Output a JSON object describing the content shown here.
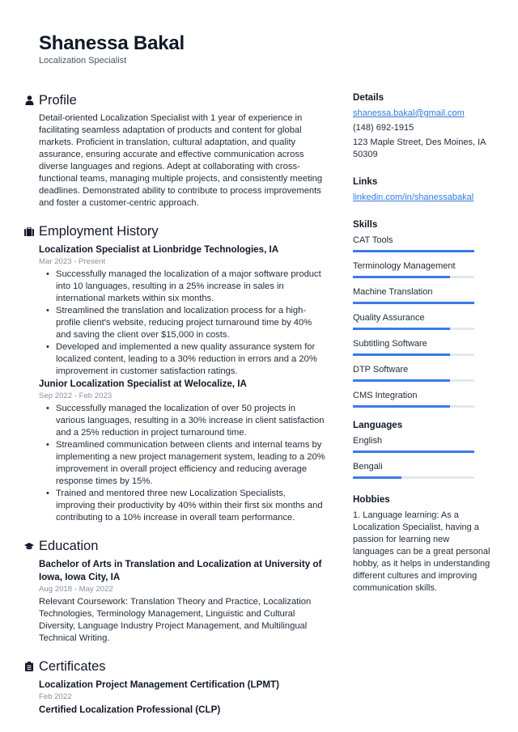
{
  "header": {
    "name": "Shanessa Bakal",
    "role": "Localization Specialist"
  },
  "profile": {
    "title": "Profile",
    "icon": "person-icon",
    "text": "Detail-oriented Localization Specialist with 1 year of experience in facilitating seamless adaptation of products and content for global markets. Proficient in translation, cultural adaptation, and quality assurance, ensuring accurate and effective communication across diverse languages and regions. Adept at collaborating with cross-functional teams, managing multiple projects, and consistently meeting deadlines. Demonstrated ability to contribute to process improvements and foster a customer-centric approach."
  },
  "employment": {
    "title": "Employment History",
    "icon": "briefcase-icon",
    "jobs": [
      {
        "title": "Localization Specialist at Lionbridge Technologies, IA",
        "dates": "Mar 2023 - Present",
        "bullets": [
          "Successfully managed the localization of a major software product into 10 languages, resulting in a 25% increase in sales in international markets within six months.",
          "Streamlined the translation and localization process for a high-profile client's website, reducing project turnaround time by 40% and saving the client over $15,000 in costs.",
          "Developed and implemented a new quality assurance system for localized content, leading to a 30% reduction in errors and a 20% improvement in customer satisfaction ratings."
        ]
      },
      {
        "title": "Junior Localization Specialist at Welocalize, IA",
        "dates": "Sep 2022 - Feb 2023",
        "bullets": [
          "Successfully managed the localization of over 50 projects in various languages, resulting in a 30% increase in client satisfaction and a 25% reduction in project turnaround time.",
          "Streamlined communication between clients and internal teams by implementing a new project management system, leading to a 20% improvement in overall project efficiency and reducing average response times by 15%.",
          "Trained and mentored three new Localization Specialists, improving their productivity by 40% within their first six months and contributing to a 10% increase in overall team performance."
        ]
      }
    ]
  },
  "education": {
    "title": "Education",
    "icon": "graduation-cap-icon",
    "items": [
      {
        "title": "Bachelor of Arts in Translation and Localization at University of Iowa, Iowa City, IA",
        "dates": "Aug 2018 - May 2022",
        "text": "Relevant Coursework: Translation Theory and Practice, Localization Technologies, Terminology Management, Linguistic and Cultural Diversity, Language Industry Project Management, and Multilingual Technical Writing."
      }
    ]
  },
  "certificates": {
    "title": "Certificates",
    "icon": "clipboard-icon",
    "items": [
      {
        "title": "Localization Project Management Certification (LPMT)",
        "date": "Feb 2022"
      },
      {
        "title": "Certified Localization Professional (CLP)",
        "date": ""
      }
    ]
  },
  "details": {
    "title": "Details",
    "email": "shanessa.bakal@gmail.com",
    "phone": "(148) 692-1915",
    "address": "123 Maple Street, Des Moines, IA 50309"
  },
  "links": {
    "title": "Links",
    "items": [
      "linkedin.com/in/shanessabakal"
    ]
  },
  "skills": {
    "title": "Skills",
    "items": [
      {
        "label": "CAT Tools",
        "level": 1.0
      },
      {
        "label": "Terminology Management",
        "level": 0.8
      },
      {
        "label": "Machine Translation",
        "level": 1.0
      },
      {
        "label": "Quality Assurance",
        "level": 0.8
      },
      {
        "label": "Subtitling Software",
        "level": 0.8
      },
      {
        "label": "DTP Software",
        "level": 0.8
      },
      {
        "label": "CMS Integration",
        "level": 0.8
      }
    ]
  },
  "languages": {
    "title": "Languages",
    "items": [
      {
        "label": "English",
        "level": 1.0
      },
      {
        "label": "Bengali",
        "level": 0.4
      }
    ]
  },
  "hobbies": {
    "title": "Hobbies",
    "text": "1. Language learning: As a Localization Specialist, having a passion for learning new languages can be a great personal hobby, as it helps in understanding different cultures and improving communication skills."
  },
  "colors": {
    "accent": "#3b7ae6",
    "link": "#2f7be0",
    "bar_track": "#e5e7eb",
    "text": "#1f2937",
    "muted": "#8a8f98"
  }
}
